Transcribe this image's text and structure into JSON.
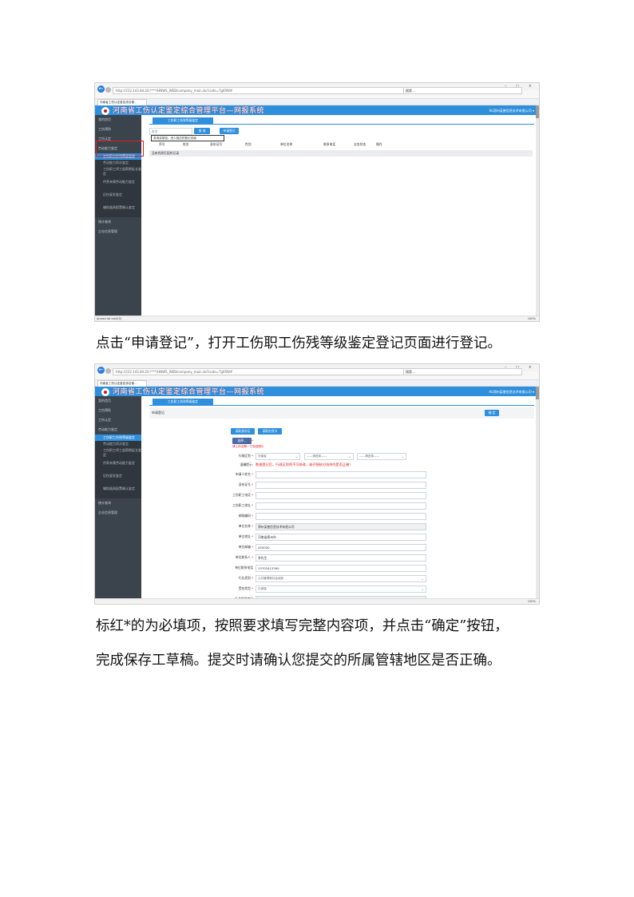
{
  "screenshot1": {
    "url": "http://222.143.84.20:****/HNWS_WEB/company_main.do?code=TgIlRW#",
    "search_placeholder": "搜索...",
    "browser_tab": "河南省工伤认定鉴定综合管...",
    "app_title": "河南省工伤认定鉴定综合管理平台—网报系统",
    "user": "HL郑州英普信息技术有限公司 ▾",
    "sidebar": [
      "我的首页",
      "工伤预防",
      "工伤认定",
      "劳动能力鉴定",
      "工伤职工伤残等级鉴定",
      "劳动能力再次鉴定",
      "工伤职工停工留薪期延长鉴定",
      "供养亲属劳动能力鉴定",
      "旧伤复发鉴定",
      "辅助器具配置确认鉴定",
      "统计查询",
      "企业信息管理"
    ],
    "tab": "工伤职工伤残等级鉴定",
    "name_placeholder": "姓名",
    "query_btn": "查 询",
    "apply_btn": "申请登记",
    "tip": "查询该按钮，进入相应的登记页面",
    "columns": [
      "序号",
      "姓名",
      "身份证号",
      "性别",
      "单位名称",
      "联系电话",
      "业务状态",
      "操作"
    ],
    "empty": "没有找到匹配的记录",
    "status": "javascript:void(0)",
    "zoom": "100%"
  },
  "instruction1": "点击“申请登记”，打开工伤职工伤残等级鉴定登记页面进行登记。",
  "screenshot2": {
    "header": "申请登记",
    "confirm": "确 定",
    "read_card_btn1": "读取身份证",
    "read_card_btn2": "读取社保卡",
    "photo_label": "一寸照片",
    "upload": "选择...",
    "photo_hint": "请上传近期一寸免冠照片",
    "region_label": "行政区划",
    "province": "河南省",
    "city": "——请选择——",
    "county": "——请选择——",
    "notice_label": "温馨提示:",
    "notice": "数据登记后，行政区划将不可修改，请仔细核对选择的是否正确！",
    "fields": [
      {
        "label": "申请人姓名",
        "value": ""
      },
      {
        "label": "身份证号",
        "value": ""
      },
      {
        "label": "工伤职工电话",
        "value": ""
      },
      {
        "label": "工伤职工地址",
        "value": ""
      },
      {
        "label": "邮政编码",
        "value": ""
      },
      {
        "label": "单位名称",
        "value": "郑州英普信息技术有限公司"
      },
      {
        "label": "单位地址",
        "value": "河南省郑州市"
      },
      {
        "label": "单位邮编",
        "value": "450000"
      },
      {
        "label": "单位联系人",
        "value": "李先生"
      },
      {
        "label": "单位联系电话",
        "value": "13703413390"
      },
      {
        "label": "行业类别",
        "value": "公共管理和社会组织"
      },
      {
        "label": "受伤类型",
        "value": "已参保"
      },
      {
        "label": "社会保险编码",
        "value": ""
      }
    ],
    "zoom": "100%"
  },
  "instruction2_line1": "标红*的为必填项，按照要求填写完整内容项，并点击“确定”按钮，",
  "instruction2_line2": "完成保存工草稿。提交时请确认您提交的所属管辖地区是否正确。"
}
